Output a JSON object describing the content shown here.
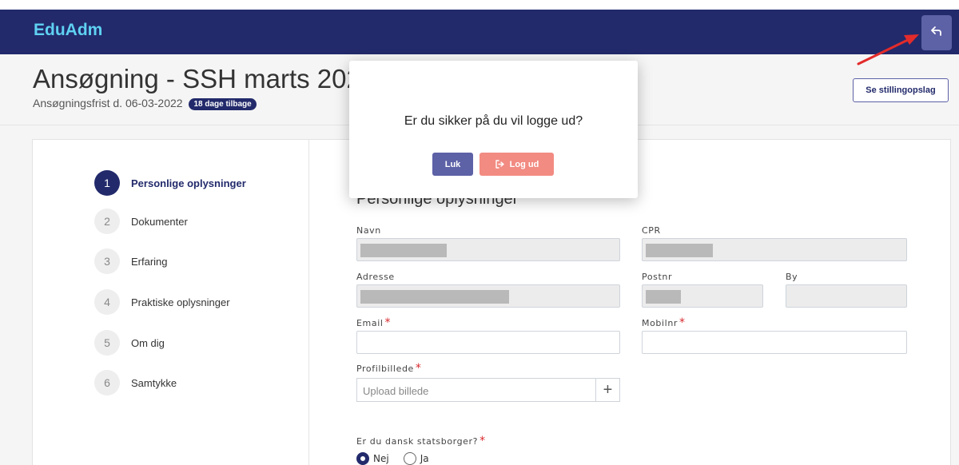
{
  "header": {
    "brand": "EduAdm",
    "back_icon": "back-arrow-icon"
  },
  "page": {
    "title": "Ansøgning - SSH marts 2022",
    "deadline_text": "Ansøgningsfrist d. 06-03-2022",
    "deadline_badge": "18 dage tilbage",
    "see_posting_button": "Se stillingopslag"
  },
  "steps": [
    {
      "num": "1",
      "label": "Personlige oplysninger",
      "active": true
    },
    {
      "num": "2",
      "label": "Dokumenter"
    },
    {
      "num": "3",
      "label": "Erfaring"
    },
    {
      "num": "4",
      "label": "Praktiske oplysninger"
    },
    {
      "num": "5",
      "label": "Om dig"
    },
    {
      "num": "6",
      "label": "Samtykke"
    }
  ],
  "form": {
    "section_title": "Personlige oplysninger",
    "navn_label": "Navn",
    "cpr_label": "CPR",
    "adresse_label": "Adresse",
    "postnr_label": "Postnr",
    "by_label": "By",
    "email_label": "Email",
    "mobil_label": "Mobilnr",
    "profilbillede_label": "Profilbillede",
    "upload_placeholder": "Upload billede",
    "citizen_question": "Er du dansk statsborger?",
    "citizen_options": [
      "Nej",
      "Ja"
    ],
    "citizen_selected": "Nej",
    "required_mark": "*"
  },
  "modal": {
    "question": "Er du sikker på du vil logge ud?",
    "close_button": "Luk",
    "logout_button": "Log ud",
    "logout_icon": "logout-icon"
  },
  "colors": {
    "navy": "#222a6b",
    "accent": "#5d61a6",
    "brand": "#5fd1f2",
    "danger_button": "#f28b82",
    "required": "#d9292e",
    "annotation_arrow": "#e32b2b"
  }
}
